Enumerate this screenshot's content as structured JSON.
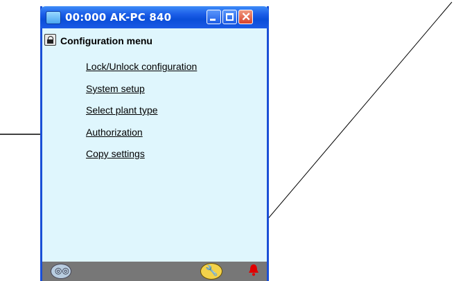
{
  "window": {
    "title": "00:000 AK-PC 840",
    "buttons": {
      "minimize_icon": "minimize-icon",
      "maximize_icon": "maximize-icon",
      "close_icon": "close-icon"
    }
  },
  "menu": {
    "title": "Configuration menu",
    "items": [
      {
        "label": "Lock/Unlock configuration"
      },
      {
        "label": "System setup"
      },
      {
        "label": "Select plant type"
      },
      {
        "label": "Authorization"
      },
      {
        "label": "Copy settings"
      }
    ]
  },
  "statusbar": {
    "left_icon": "glasses-icon",
    "tool_icon": "wrench-icon",
    "alarm_icon": "bell-icon",
    "alarm_color": "#e00000"
  }
}
